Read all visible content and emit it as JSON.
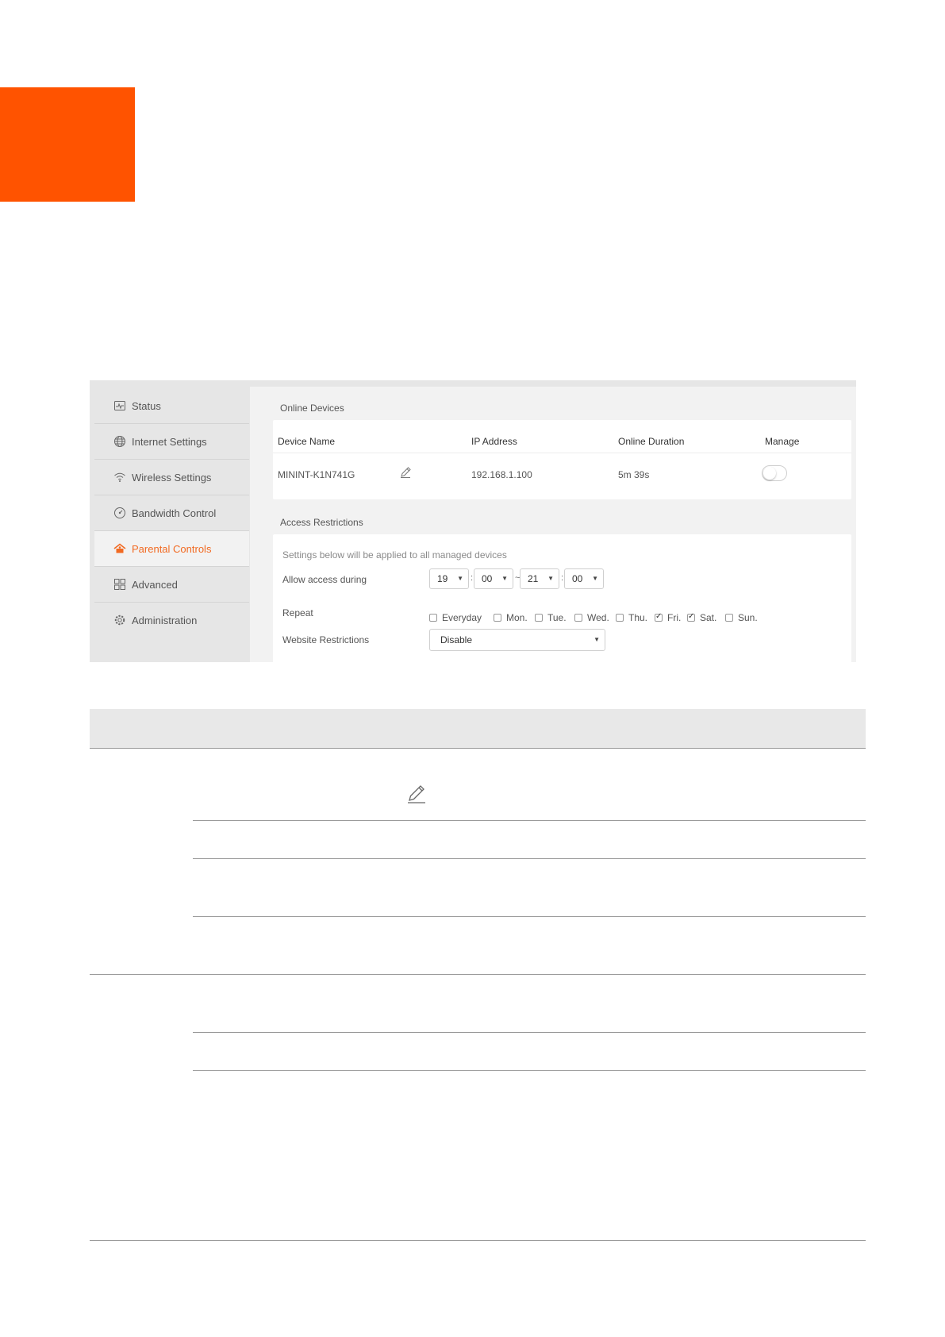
{
  "sidebar": {
    "items": [
      {
        "label": "Status",
        "icon": "status-icon"
      },
      {
        "label": "Internet Settings",
        "icon": "globe-icon"
      },
      {
        "label": "Wireless Settings",
        "icon": "wifi-icon"
      },
      {
        "label": "Bandwidth Control",
        "icon": "gauge-icon"
      },
      {
        "label": "Parental Controls",
        "icon": "parental-controls-icon",
        "active": true
      },
      {
        "label": "Advanced",
        "icon": "grid-icon"
      },
      {
        "label": "Administration",
        "icon": "gear-icon"
      }
    ]
  },
  "online_devices": {
    "title": "Online Devices",
    "headers": {
      "device_name": "Device Name",
      "ip": "IP Address",
      "duration": "Online Duration",
      "manage": "Manage"
    },
    "row": {
      "device_name": "MININT-K1N741G",
      "ip": "192.168.1.100",
      "duration": "5m 39s",
      "manage": false
    }
  },
  "access": {
    "title": "Access Restrictions",
    "hint": "Settings below will be applied to all managed devices",
    "allow_label": "Allow access during",
    "start_hour": "19",
    "start_min": "00",
    "end_hour": "21",
    "end_min": "00",
    "tilde": "~",
    "colon": ":",
    "repeat_label": "Repeat",
    "days": [
      {
        "label": "Everyday",
        "checked": false
      },
      {
        "label": "Mon.",
        "checked": false
      },
      {
        "label": "Tue.",
        "checked": false
      },
      {
        "label": "Wed.",
        "checked": false
      },
      {
        "label": "Thu.",
        "checked": false
      },
      {
        "label": "Fri.",
        "checked": true
      },
      {
        "label": "Sat.",
        "checked": true
      },
      {
        "label": "Sun.",
        "checked": false
      }
    ],
    "website_label": "Website Restrictions",
    "website_value": "Disable"
  },
  "colors": {
    "brand": "#ff5300",
    "active_nav": "#f26a22"
  }
}
